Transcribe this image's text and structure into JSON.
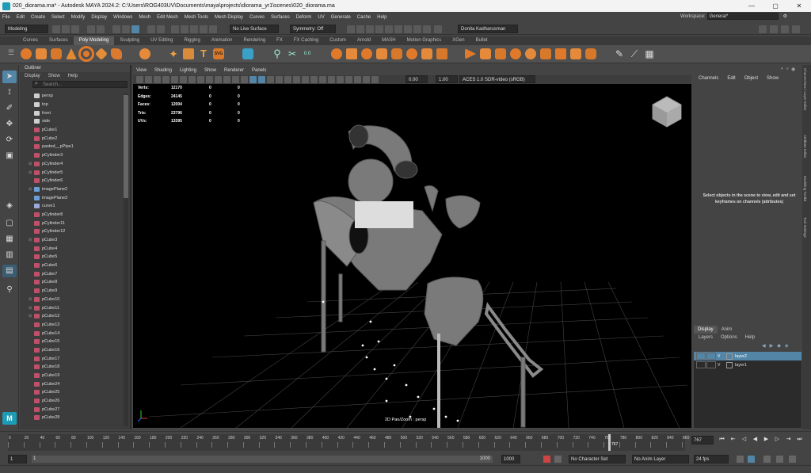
{
  "window": {
    "title": "020_diorama.ma* - Autodesk MAYA 2024.2: C:\\Users\\ROG403UV\\Documents\\maya\\projects\\diorama_yr1\\scenes\\020_diorama.ma"
  },
  "menubar": [
    "File",
    "Edit",
    "Create",
    "Select",
    "Modify",
    "Display",
    "Windows",
    "Mesh",
    "Edit Mesh",
    "Mesh Tools",
    "Mesh Display",
    "Curves",
    "Surfaces",
    "Deform",
    "UV",
    "Generate",
    "Cache",
    "Help"
  ],
  "workspace": {
    "label": "Workspace:",
    "value": "General*"
  },
  "statusline": {
    "mode": "Modeling",
    "live_surface": "No Live Surface",
    "symmetry": "Symmetry: Off",
    "user": "Donita Kadharusman"
  },
  "shelf_tabs": [
    "Curves",
    "Surfaces",
    "Poly Modeling",
    "Sculpting",
    "UV Editing",
    "Rigging",
    "Animation",
    "Rendering",
    "FX",
    "FX Caching",
    "Custom",
    "Arnold",
    "MASH",
    "Motion Graphics",
    "XGen",
    "Bullet"
  ],
  "shelf_active": "Poly Modeling",
  "outliner": {
    "title": "Outliner",
    "menu": [
      "Display",
      "Show",
      "Help"
    ],
    "search_placeholder": "Search...",
    "items": [
      {
        "name": "persp",
        "type": "cam",
        "exp": false
      },
      {
        "name": "top",
        "type": "cam",
        "exp": false
      },
      {
        "name": "front",
        "type": "cam",
        "exp": false
      },
      {
        "name": "side",
        "type": "cam",
        "exp": false
      },
      {
        "name": "pCube1",
        "type": "mesh",
        "exp": false
      },
      {
        "name": "pCube2",
        "type": "mesh",
        "exp": false
      },
      {
        "name": "pasted__pPipe1",
        "type": "mesh",
        "exp": false
      },
      {
        "name": "pCylinder3",
        "type": "mesh",
        "exp": false
      },
      {
        "name": "pCylinder4",
        "type": "mesh",
        "exp": true
      },
      {
        "name": "pCylinder5",
        "type": "mesh",
        "exp": true
      },
      {
        "name": "pCylinder6",
        "type": "mesh",
        "exp": false
      },
      {
        "name": "imagePlane2",
        "type": "img",
        "exp": true
      },
      {
        "name": "imagePlane3",
        "type": "img",
        "exp": false
      },
      {
        "name": "curve1",
        "type": "curve",
        "exp": false
      },
      {
        "name": "pCylinder8",
        "type": "mesh",
        "exp": false
      },
      {
        "name": "pCylinder11",
        "type": "mesh",
        "exp": false
      },
      {
        "name": "pCylinder12",
        "type": "mesh",
        "exp": false
      },
      {
        "name": "pCube3",
        "type": "mesh",
        "exp": true
      },
      {
        "name": "pCube4",
        "type": "mesh",
        "exp": false
      },
      {
        "name": "pCube5",
        "type": "mesh",
        "exp": false
      },
      {
        "name": "pCube6",
        "type": "mesh",
        "exp": false
      },
      {
        "name": "pCube7",
        "type": "mesh",
        "exp": false
      },
      {
        "name": "pCube8",
        "type": "mesh",
        "exp": false
      },
      {
        "name": "pCube9",
        "type": "mesh",
        "exp": false
      },
      {
        "name": "pCube10",
        "type": "mesh",
        "exp": true
      },
      {
        "name": "pCube11",
        "type": "mesh",
        "exp": true
      },
      {
        "name": "pCube12",
        "type": "mesh",
        "exp": true
      },
      {
        "name": "pCube13",
        "type": "mesh",
        "exp": false
      },
      {
        "name": "pCube14",
        "type": "mesh",
        "exp": false
      },
      {
        "name": "pCube15",
        "type": "mesh",
        "exp": false
      },
      {
        "name": "pCube16",
        "type": "mesh",
        "exp": false
      },
      {
        "name": "pCube17",
        "type": "mesh",
        "exp": false
      },
      {
        "name": "pCube18",
        "type": "mesh",
        "exp": false
      },
      {
        "name": "pCube19",
        "type": "mesh",
        "exp": false
      },
      {
        "name": "pCube24",
        "type": "mesh",
        "exp": false
      },
      {
        "name": "pCube25",
        "type": "mesh",
        "exp": false
      },
      {
        "name": "pCube26",
        "type": "mesh",
        "exp": false
      },
      {
        "name": "pCube27",
        "type": "mesh",
        "exp": false
      },
      {
        "name": "pCube28",
        "type": "mesh",
        "exp": false
      }
    ]
  },
  "panel_menu": [
    "View",
    "Shading",
    "Lighting",
    "Show",
    "Renderer",
    "Panels"
  ],
  "panel_toolbar": {
    "exposure": "0.00",
    "gamma": "1.00",
    "colorspace": "ACES 1.0 SDR-video (sRGB)"
  },
  "hud": [
    {
      "label": "Verts:",
      "a": "12170",
      "b": "0",
      "c": "0"
    },
    {
      "label": "Edges:",
      "a": "24145",
      "b": "0",
      "c": "0"
    },
    {
      "label": "Faces:",
      "a": "12004",
      "b": "0",
      "c": "0"
    },
    {
      "label": "Tris:",
      "a": "23796",
      "b": "0",
      "c": "0"
    },
    {
      "label": "UVs:",
      "a": "13395",
      "b": "0",
      "c": "0"
    }
  ],
  "camera_label": "2D Pan/Zoom : persp",
  "channel_box": {
    "menu": [
      "Channels",
      "Edit",
      "Object",
      "Show"
    ],
    "message": "Select objects in the scene to view, edit and set keyframes on channels (attributes)"
  },
  "layer_editor": {
    "tabs": [
      "Display",
      "Anim"
    ],
    "menu": [
      "Layers",
      "Options",
      "Help"
    ],
    "layers": [
      {
        "name": "layer2",
        "visible": "V",
        "selected": true
      },
      {
        "name": "layer1",
        "visible": "V",
        "selected": false
      }
    ]
  },
  "side_tabs": [
    "Channel Box / Layer Editor",
    "Attribute Editor",
    "Modeling Toolkit",
    "Tool Settings"
  ],
  "timeline": {
    "ticks": [
      "0",
      "20",
      "40",
      "60",
      "80",
      "100",
      "120",
      "140",
      "160",
      "180",
      "200",
      "220",
      "240",
      "260",
      "280",
      "300",
      "320",
      "340",
      "360",
      "380",
      "400",
      "420",
      "440",
      "460",
      "480",
      "500",
      "520",
      "540",
      "560",
      "580",
      "600",
      "620",
      "640",
      "660",
      "680",
      "700",
      "720",
      "740",
      "760",
      "780",
      "800",
      "820",
      "840",
      "860"
    ],
    "current_frame": "767",
    "playhead_label": "767",
    "min": 0,
    "max": 864,
    "current": 767
  },
  "range": {
    "start": "1",
    "inner_start": "1",
    "inner_end": "1000",
    "end": "1000",
    "character_set": "No Character Set",
    "anim_layer": "No Anim Layer",
    "fps": "24 fps"
  },
  "colors": {
    "mesh_icon": "#c0506a",
    "cam_icon": "#cfcfcf",
    "img_icon": "#6aa0d8",
    "curve_icon": "#9ad",
    "accent": "#5285a6"
  }
}
